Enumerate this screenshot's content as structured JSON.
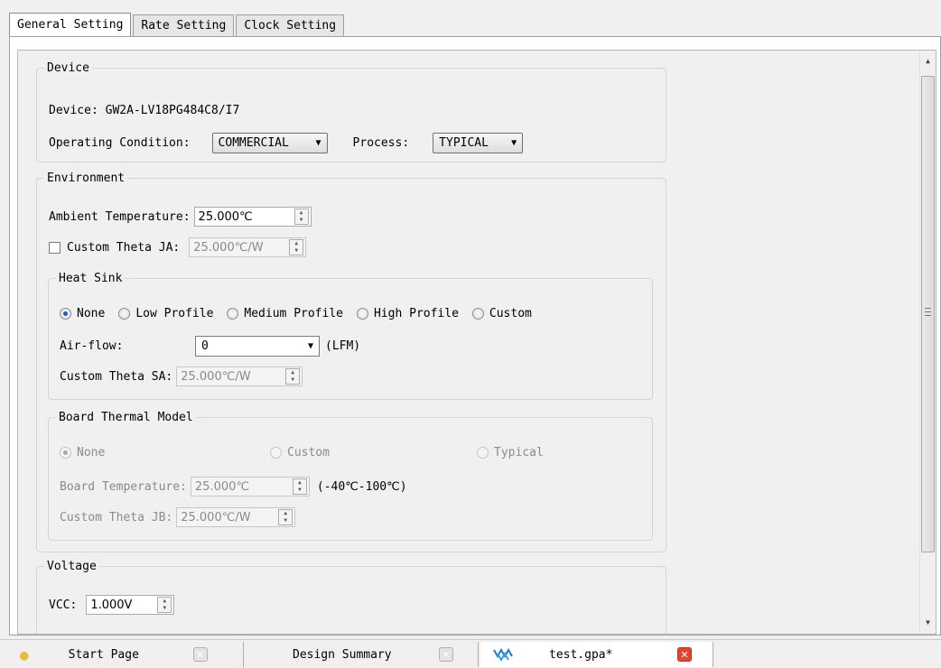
{
  "tabs": [
    "General Setting",
    "Rate Setting",
    "Clock Setting"
  ],
  "device": {
    "legend": "Device",
    "device_label": "Device: GW2A-LV18PG484C8/I7",
    "operating_label": "Operating Condition:",
    "operating_value": "COMMERCIAL",
    "process_label": "Process:",
    "process_value": "TYPICAL"
  },
  "environment": {
    "legend": "Environment",
    "ambient_label": "Ambient Temperature:",
    "ambient_value": "25.000℃",
    "custom_theta_ja_label": "Custom Theta JA:",
    "custom_theta_ja_value": "25.000℃/W"
  },
  "heat_sink": {
    "legend": "Heat Sink",
    "options": [
      "None",
      "Low Profile",
      "Medium Profile",
      "High Profile",
      "Custom"
    ],
    "selected": "None",
    "airflow_label": "Air-flow:",
    "airflow_value": "0",
    "airflow_unit": "(LFM)",
    "custom_theta_sa_label": "Custom Theta SA:",
    "custom_theta_sa_value": "25.000℃/W"
  },
  "board_thermal": {
    "legend": "Board Thermal Model",
    "options": [
      "None",
      "Custom",
      "Typical"
    ],
    "selected": "None",
    "board_temp_label": "Board Temperature:",
    "board_temp_value": "25.000℃",
    "board_temp_range": "(-40℃-100℃)",
    "custom_theta_jb_label": "Custom Theta  JB:",
    "custom_theta_jb_value": "25.000℃/W"
  },
  "voltage": {
    "legend": "Voltage",
    "vcc_label": "VCC:",
    "vcc_value": "1.000V"
  },
  "bottom_tabs": [
    "Start Page",
    "Design Summary",
    "test.gpa*"
  ],
  "colors": {
    "accent_blue": "#1d5fbf",
    "close_red": "#e5452f"
  }
}
